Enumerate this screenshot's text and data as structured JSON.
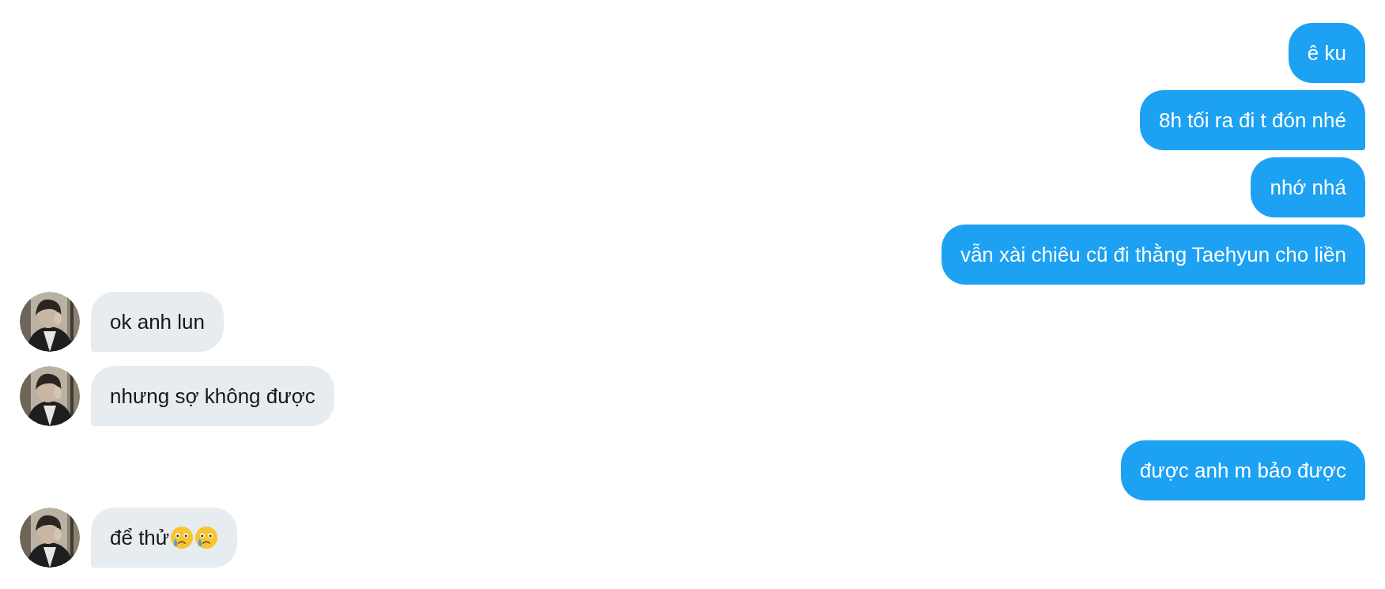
{
  "messages": [
    {
      "kind": "sent",
      "text": "ê ku"
    },
    {
      "kind": "sent",
      "text": "8h tối ra đi t đón nhé"
    },
    {
      "kind": "sent",
      "text": "nhớ nhá"
    },
    {
      "kind": "sent",
      "text": "vẫn xài chiêu cũ đi thằng Taehyun cho liền"
    },
    {
      "kind": "received",
      "text": "ok anh lun"
    },
    {
      "kind": "received",
      "text": "nhưng sợ không được"
    },
    {
      "kind": "sent",
      "text": "được anh m bảo được"
    },
    {
      "kind": "received",
      "text": "để thử",
      "emojis": [
        {
          "kind": "crying"
        },
        {
          "kind": "crying"
        }
      ]
    }
  ]
}
